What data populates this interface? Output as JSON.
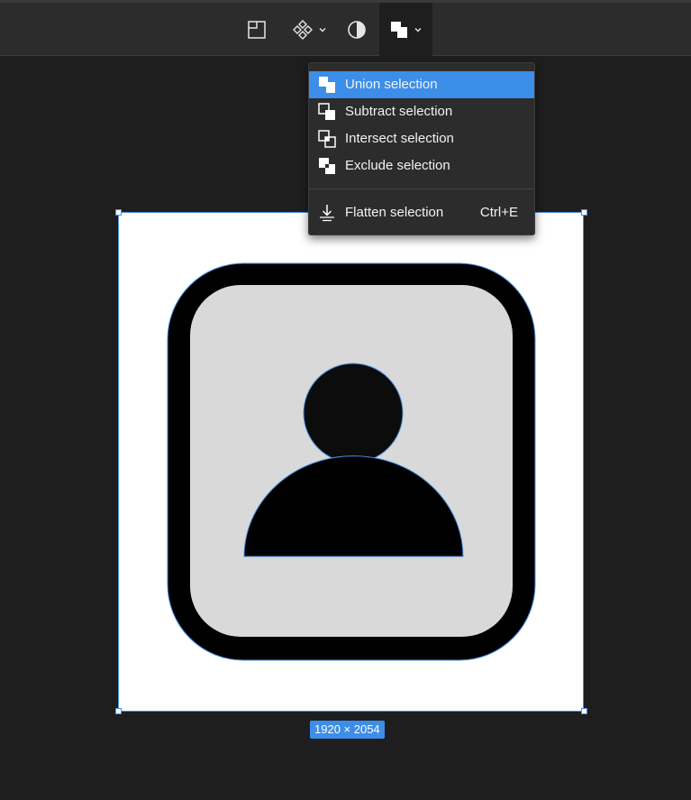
{
  "toolbar": {
    "buttons": [
      {
        "name": "frame",
        "icon": "frame-icon"
      },
      {
        "name": "components",
        "icon": "component-icon"
      },
      {
        "name": "mask",
        "icon": "contrast-icon"
      },
      {
        "name": "boolean",
        "icon": "boolean-union-icon",
        "active": true
      }
    ]
  },
  "boolean_menu": {
    "items": [
      {
        "label": "Union selection",
        "icon": "union-icon",
        "highlighted": true
      },
      {
        "label": "Subtract selection",
        "icon": "subtract-icon"
      },
      {
        "label": "Intersect selection",
        "icon": "intersect-icon"
      },
      {
        "label": "Exclude selection",
        "icon": "exclude-icon"
      }
    ],
    "flatten": {
      "label": "Flatten selection",
      "shortcut": "Ctrl+E",
      "icon": "flatten-icon"
    }
  },
  "selection": {
    "dimensions": "1920 × 2054"
  },
  "colors": {
    "accent": "#3c8ee8",
    "canvas_bg": "#1e1e1e",
    "toolbar_bg": "#2c2c2c",
    "menu_bg": "#2c2c2c"
  }
}
